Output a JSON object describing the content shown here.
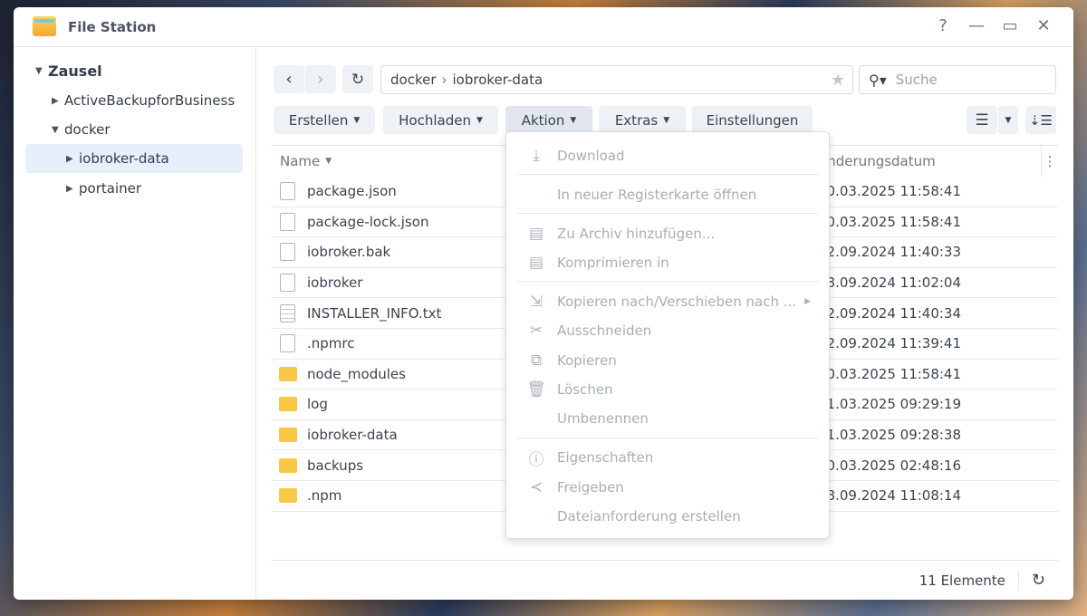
{
  "window": {
    "title": "File Station",
    "help": "?",
    "minimize": "—",
    "maximize": "▭",
    "close": "✕"
  },
  "sidebar": {
    "root": "Zausel",
    "items": [
      {
        "label": "ActiveBackupforBusiness"
      },
      {
        "label": "docker"
      },
      {
        "label": "iobroker-data"
      },
      {
        "label": "portainer"
      }
    ]
  },
  "toolbar": {
    "path": [
      "docker",
      "iobroker-data"
    ],
    "search_placeholder": "Suche",
    "buttons": [
      "Erstellen",
      "Hochladen",
      "Aktion",
      "Extras",
      "Einstellungen"
    ]
  },
  "table": {
    "headers": {
      "name": "Name",
      "date": "Änderungsdatum"
    },
    "rows": [
      {
        "name": "package.json",
        "type": "file",
        "date": "30.03.2025 11:58:41"
      },
      {
        "name": "package-lock.json",
        "type": "file",
        "date": "30.03.2025 11:58:41"
      },
      {
        "name": "iobroker.bak",
        "type": "file",
        "date": "12.09.2024 11:40:33"
      },
      {
        "name": "iobroker",
        "type": "file",
        "date": "18.09.2024 11:02:04"
      },
      {
        "name": "INSTALLER_INFO.txt",
        "type": "text",
        "date": "12.09.2024 11:40:34"
      },
      {
        "name": ".npmrc",
        "type": "file",
        "date": "12.09.2024 11:39:41"
      },
      {
        "name": "node_modules",
        "type": "folder",
        "date": "30.03.2025 11:58:41"
      },
      {
        "name": "log",
        "type": "folder",
        "date": "31.03.2025 09:29:19"
      },
      {
        "name": "iobroker-data",
        "type": "folder",
        "date": "31.03.2025 09:28:38"
      },
      {
        "name": "backups",
        "type": "folder",
        "date": "20.03.2025 02:48:16"
      },
      {
        "name": ".npm",
        "type": "folder",
        "date": "18.09.2024 11:08:14"
      }
    ]
  },
  "footer": {
    "count": "11 Elemente"
  },
  "menu": {
    "items": [
      "Download",
      "In neuer Registerkarte öffnen",
      "Zu Archiv hinzufügen...",
      "Komprimieren in",
      "Kopieren nach/Verschieben nach ...",
      "Ausschneiden",
      "Kopieren",
      "Löschen",
      "Umbenennen",
      "Eigenschaften",
      "Freigeben",
      "Dateianforderung erstellen"
    ]
  }
}
